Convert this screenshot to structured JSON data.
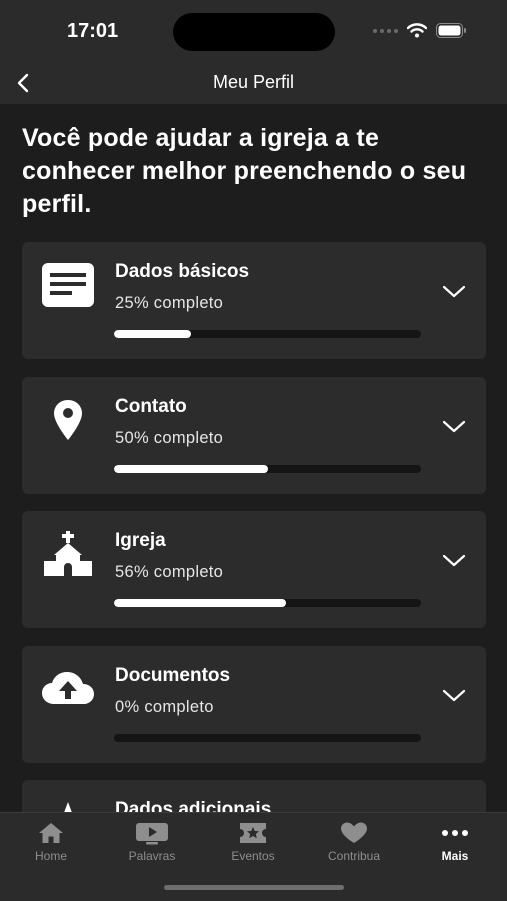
{
  "status_bar": {
    "time": "17:01"
  },
  "nav": {
    "title": "Meu Perfil",
    "back_icon": "chevron-left-icon"
  },
  "intro_text": "Você pode ajudar a igreja a te conhecer melhor preenchendo o seu perfil.",
  "cards": [
    {
      "title": "Dados básicos",
      "status": "25% completo",
      "progress": 0.25,
      "icon": "document-icon"
    },
    {
      "title": "Contato",
      "status": "50% completo",
      "progress": 0.5,
      "icon": "location-pin-icon"
    },
    {
      "title": "Igreja",
      "status": "56% completo",
      "progress": 0.56,
      "icon": "church-icon"
    },
    {
      "title": "Documentos",
      "status": "0% completo",
      "progress": 0.0,
      "icon": "cloud-upload-icon"
    },
    {
      "title": "Dados adicionais",
      "icon": "star-icon"
    }
  ],
  "tabs": [
    {
      "label": "Home",
      "icon": "home-icon",
      "active": false
    },
    {
      "label": "Palavras",
      "icon": "video-icon",
      "active": false
    },
    {
      "label": "Eventos",
      "icon": "ticket-icon",
      "active": false
    },
    {
      "label": "Contribua",
      "icon": "heart-icon",
      "active": false
    },
    {
      "label": "Mais",
      "icon": "more-dots-icon",
      "active": true
    }
  ],
  "colors": {
    "background": "#1d1d1d",
    "card": "#2c2c2c",
    "bar": "#2b2b2b",
    "progress": "#ffffff",
    "inactive_tab": "#8e8e8e"
  }
}
